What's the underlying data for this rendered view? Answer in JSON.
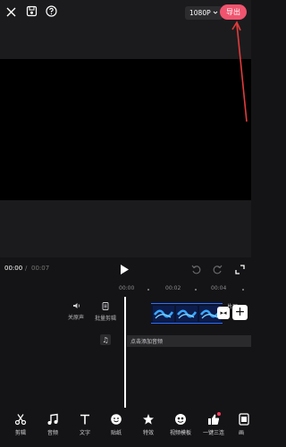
{
  "header": {
    "resolution": "1080P",
    "export_label": "导出"
  },
  "player": {
    "current_time": "00:00",
    "separator": "/",
    "total_time": "00:07"
  },
  "timeline": {
    "ruler": [
      "00:00",
      "00:02",
      "00:04"
    ],
    "tools": [
      {
        "label": "关原声",
        "icon": "speaker-icon"
      },
      {
        "label": "批量剪辑",
        "icon": "batch-edit-icon"
      }
    ],
    "tail_label": "片尾",
    "add_audio_label": "点击添加音频"
  },
  "toolbar": {
    "items": [
      {
        "label": "剪辑",
        "icon": "scissors-icon"
      },
      {
        "label": "音频",
        "icon": "music-note-icon"
      },
      {
        "label": "文字",
        "icon": "text-icon"
      },
      {
        "label": "贴纸",
        "icon": "sticker-icon"
      },
      {
        "label": "特效",
        "icon": "effects-star-icon"
      },
      {
        "label": "视频模板",
        "icon": "template-icon"
      },
      {
        "label": "一键三连",
        "icon": "thumbs-up-icon"
      },
      {
        "label": "画",
        "icon": "canvas-icon"
      }
    ]
  },
  "colors": {
    "accent": "#f0546e",
    "clip_border": "#2f6fff",
    "background": "#141416"
  }
}
